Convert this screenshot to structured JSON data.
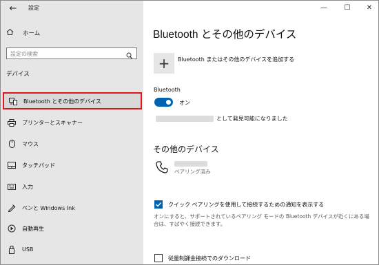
{
  "window": {
    "title": "設定",
    "back_icon": "back-arrow-icon",
    "controls": {
      "minimize": "—",
      "maximize": "☐",
      "close": "✕"
    }
  },
  "sidebar": {
    "home_label": "ホーム",
    "search_placeholder": "設定の検索",
    "section_header": "デバイス",
    "items": [
      {
        "label": "Bluetooth とその他のデバイス",
        "icon": "bluetooth-devices-icon",
        "selected": true
      },
      {
        "label": "プリンターとスキャナー",
        "icon": "printer-icon"
      },
      {
        "label": "マウス",
        "icon": "mouse-icon"
      },
      {
        "label": "タッチパッド",
        "icon": "touchpad-icon"
      },
      {
        "label": "入力",
        "icon": "keyboard-icon"
      },
      {
        "label": "ペンと Windows Ink",
        "icon": "pen-icon"
      },
      {
        "label": "自動再生",
        "icon": "autoplay-icon"
      },
      {
        "label": "USB",
        "icon": "usb-icon"
      }
    ]
  },
  "main": {
    "title": "Bluetooth とその他のデバイス",
    "add_device_label": "Bluetooth またはその他のデバイスを追加する",
    "add_symbol": "+",
    "bluetooth_label": "Bluetooth",
    "toggle_state": "オン",
    "discoverable_text": "として発見可能になりました",
    "other_devices_header": "その他のデバイス",
    "device_status": "ペアリング済み",
    "swift_pair_label": "クイック ペアリングを使用して接続するための通知を表示する",
    "swift_pair_checked": true,
    "swift_pair_description": "オンにすると、サポートされているペアリング モードの Bluetooth デバイスが近くにある場合は、すばやく接続できます。",
    "metered_label": "従量制課金接続でのダウンロード",
    "metered_checked": false
  },
  "colors": {
    "accent": "#0063b1",
    "sidebar_bg": "#e6e6e6",
    "highlight_border": "#e0141b"
  }
}
